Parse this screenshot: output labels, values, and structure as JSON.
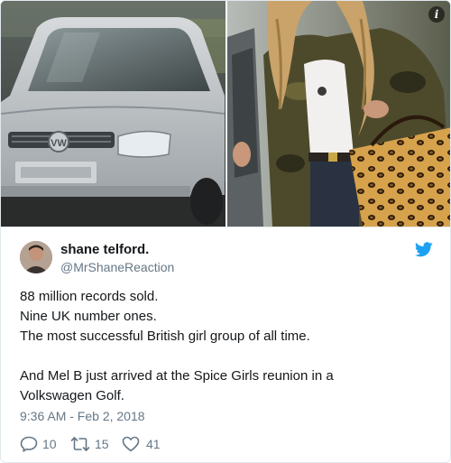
{
  "media": {
    "left_photo_alt": "",
    "right_photo_alt": ""
  },
  "tweet": {
    "author": {
      "name": "shane telford.",
      "handle": "@MrShaneReaction"
    },
    "text_lines": [
      "88 million records sold.",
      "Nine UK number ones.",
      "The most successful British girl group of all time.",
      "",
      "And Mel B just arrived at the Spice Girls reunion in a",
      "Volkswagen Golf."
    ],
    "timestamp": "9:36 AM - Feb 2, 2018",
    "stats": {
      "replies": "10",
      "retweets": "15",
      "likes": "41"
    }
  },
  "icons": {
    "info": "info-icon",
    "brand": "twitter-bird-icon",
    "reply": "reply-icon",
    "retweet": "retweet-icon",
    "like": "heart-icon"
  },
  "colors": {
    "twitter_blue": "#1da1f2",
    "text": "#14171a",
    "secondary": "#657786",
    "border": "#e1e8ed"
  }
}
